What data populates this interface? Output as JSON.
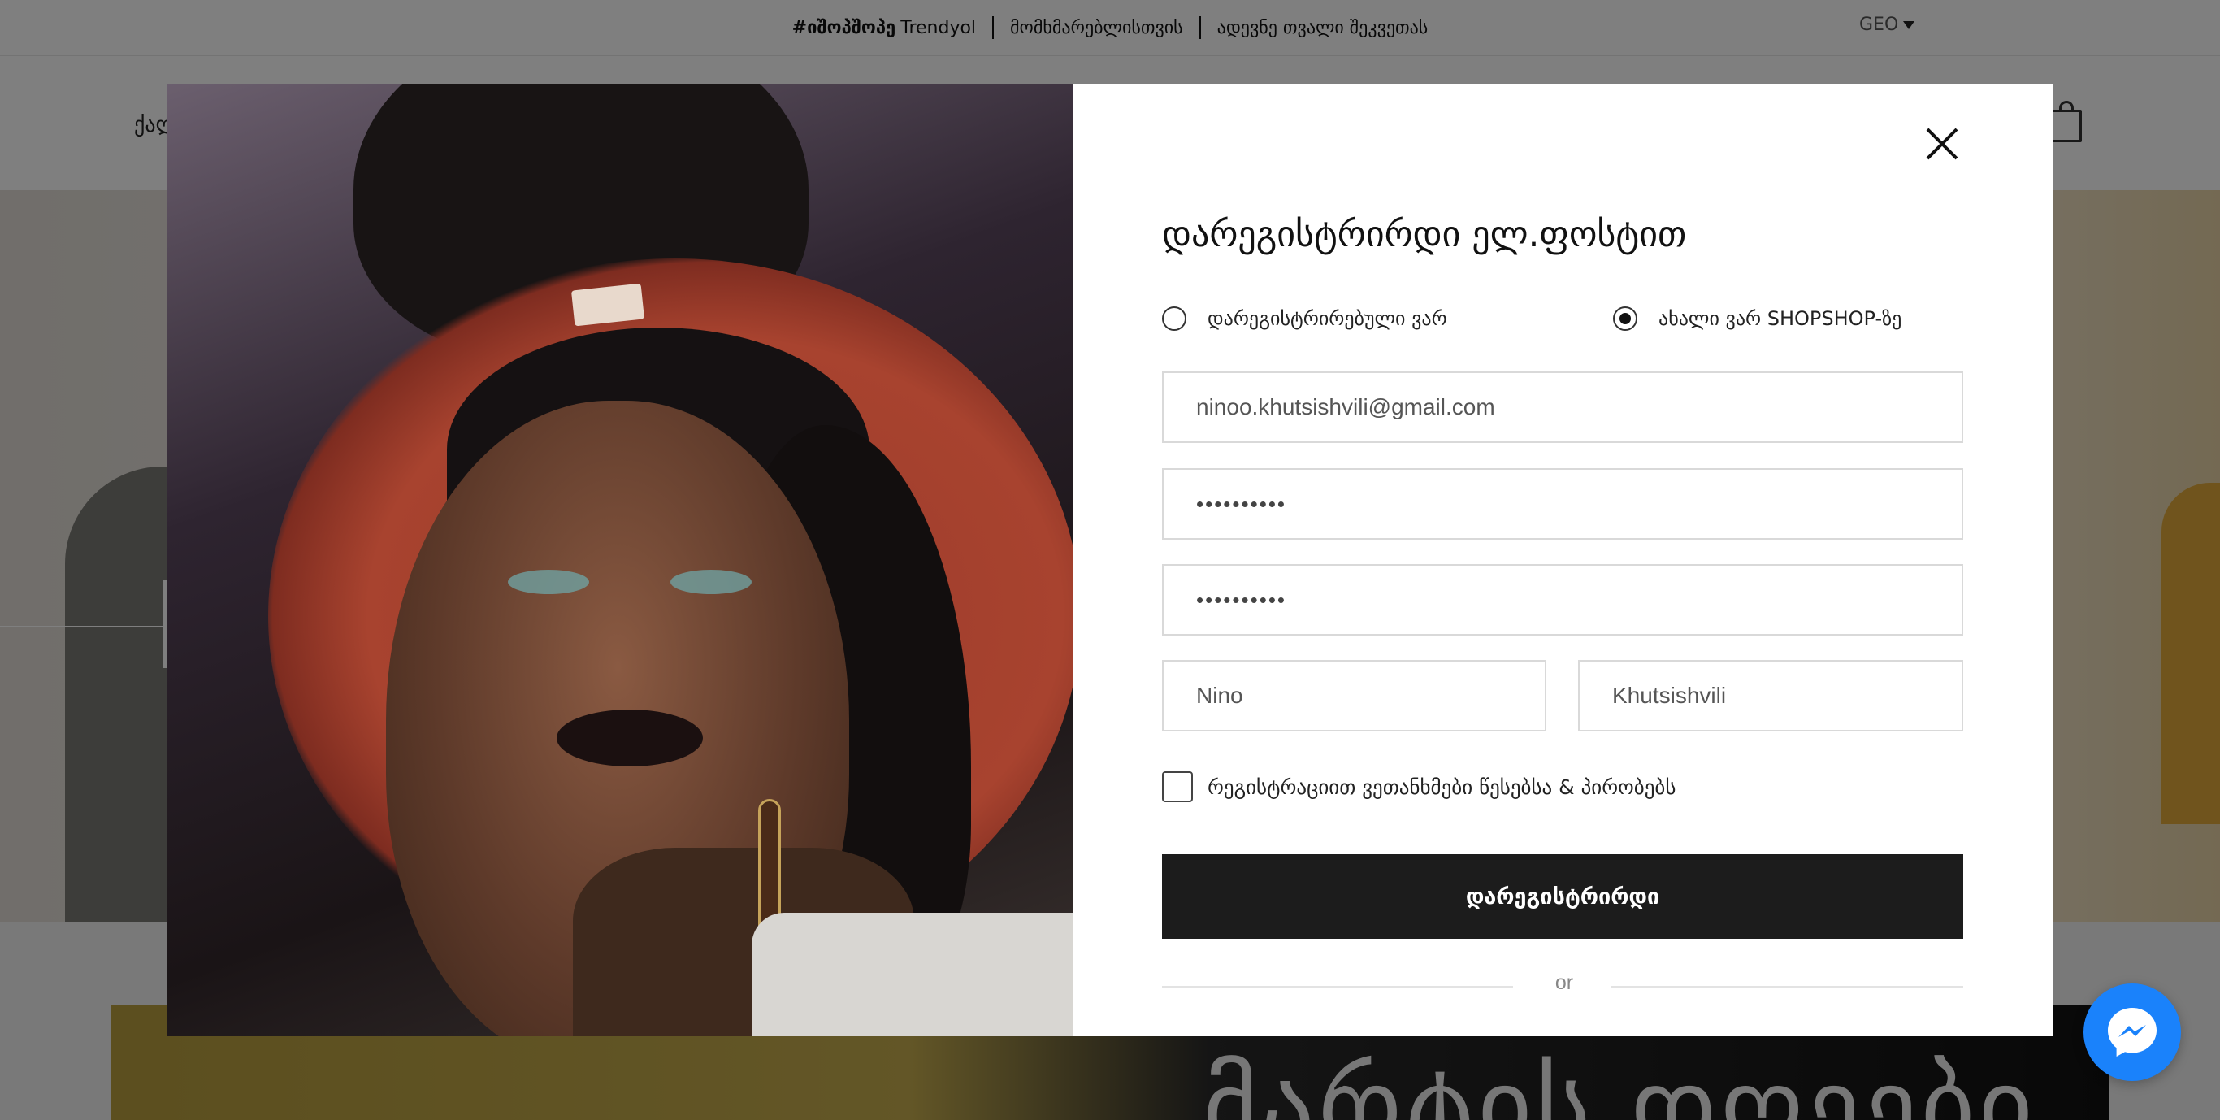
{
  "topbar": {
    "promo_strong": "#იშოპშოპე",
    "promo_rest": "Trendyol",
    "link_customers": "მომხმარებლისთვის",
    "link_track": "ადევნე თვალი შეკვეთას",
    "language": "GEO"
  },
  "nav": {
    "first_item_partial": "ქალ"
  },
  "banner": {
    "title": "მარტის დღეები"
  },
  "modal": {
    "title": "დარეგისტრირდი ელ.ფოსტით",
    "radio_registered": "დარეგისტრირებული ვარ",
    "radio_new": "ახალი ვარ SHOPSHOP-ზე",
    "selected_option": "new",
    "email_value": "ninoo.khutsishvili@gmail.com",
    "password_value": "••••••••••",
    "password_confirm_value": "••••••••••",
    "first_name_value": "Nino",
    "last_name_value": "Khutsishvili",
    "terms_label": "რეგისტრაციით ვეთანხმები წესებსა & პირობებს",
    "submit_label": "დარეგისტრირდი",
    "divider_text": "or"
  },
  "colors": {
    "submit_bg": "#1c1c1c",
    "messenger": "#1a82fb"
  },
  "icons": {
    "close": "close-icon",
    "bag": "shopping-bag-icon",
    "messenger": "messenger-icon",
    "language_caret": "caret-down-icon"
  }
}
